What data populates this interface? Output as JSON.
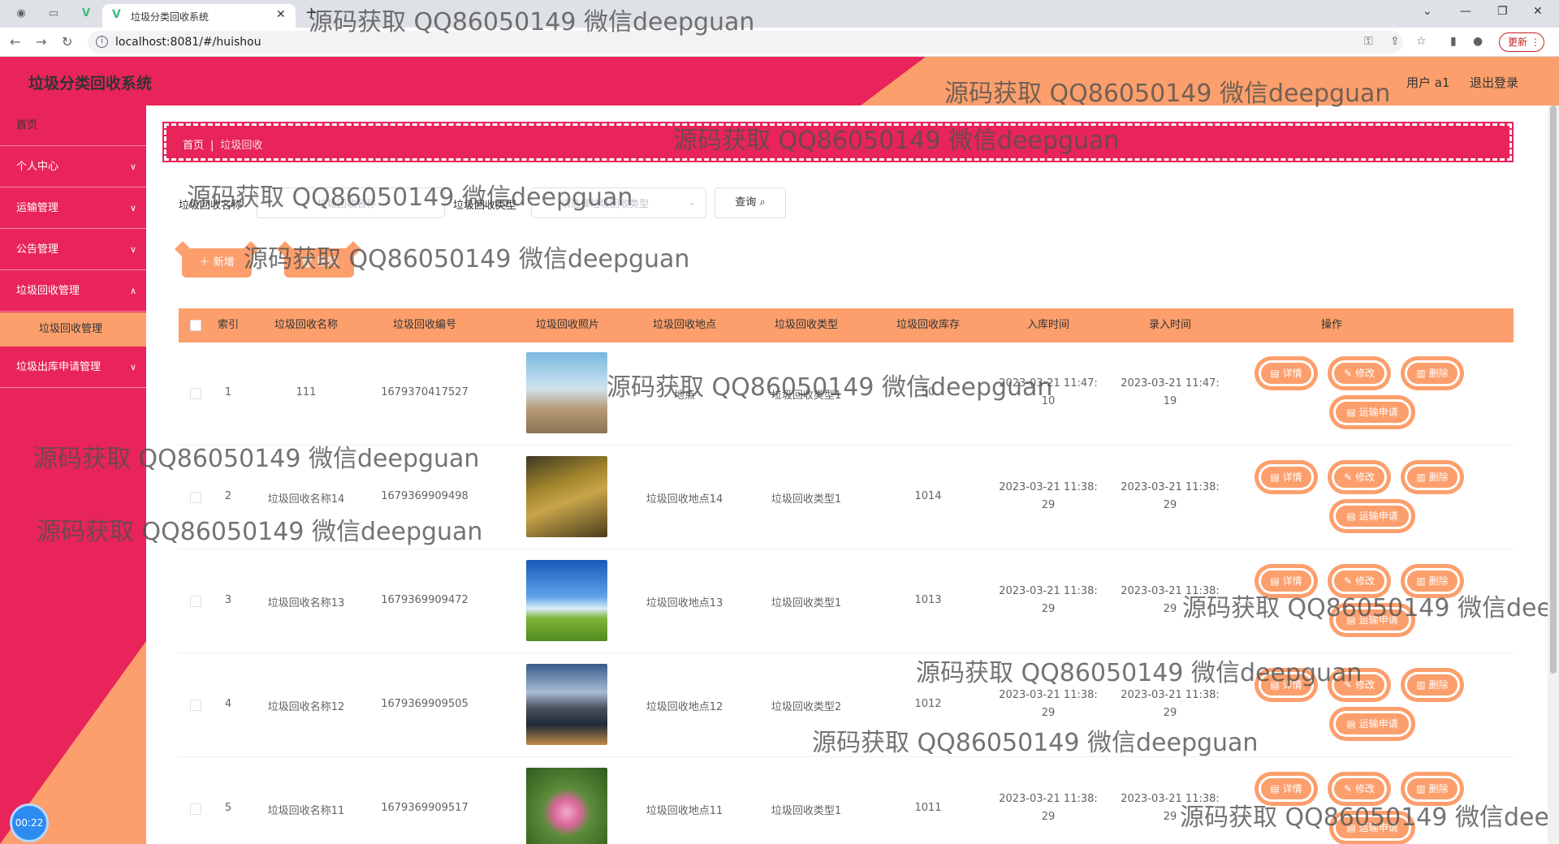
{
  "browser": {
    "tab_title": "垃圾分类回收系统",
    "url": "localhost:8081/#/huishou",
    "update_label": "更新"
  },
  "header": {
    "app_title": "垃圾分类回收系统",
    "user_label": "用户 a1",
    "logout_label": "退出登录"
  },
  "sidebar": {
    "items": [
      {
        "label": "首页"
      },
      {
        "label": "个人中心"
      },
      {
        "label": "运输管理"
      },
      {
        "label": "公告管理"
      },
      {
        "label": "垃圾回收管理"
      },
      {
        "label": "垃圾回收管理"
      },
      {
        "label": "垃圾出库申请管理"
      }
    ],
    "timer": "00:22"
  },
  "breadcrumb": {
    "home": "首页",
    "current": "垃圾回收"
  },
  "filters": {
    "name_label": "垃圾回收名称",
    "name_placeholder": "垃圾回收名称",
    "type_label": "垃圾回收类型",
    "type_placeholder": "请选择垃圾回收类型",
    "search_label": "查询"
  },
  "actions": {
    "add_label": "新增",
    "delete_label": "删除"
  },
  "table": {
    "headers": [
      "索引",
      "垃圾回收名称",
      "垃圾回收编号",
      "垃圾回收照片",
      "垃圾回收地点",
      "垃圾回收类型",
      "垃圾回收库存",
      "入库时间",
      "录入时间",
      "操作"
    ],
    "rows": [
      {
        "index": "1",
        "name": "111",
        "code": "1679370417527",
        "place": "地点",
        "type": "垃圾回收类型1",
        "stock": "50",
        "in_time_1": "2023-03-21 11:47:",
        "in_time_2": "10",
        "rec_time_1": "2023-03-21 11:47:",
        "rec_time_2": "19"
      },
      {
        "index": "2",
        "name": "垃圾回收名称14",
        "code": "1679369909498",
        "place": "垃圾回收地点14",
        "type": "垃圾回收类型1",
        "stock": "1014",
        "in_time_1": "2023-03-21 11:38:",
        "in_time_2": "29",
        "rec_time_1": "2023-03-21 11:38:",
        "rec_time_2": "29"
      },
      {
        "index": "3",
        "name": "垃圾回收名称13",
        "code": "1679369909472",
        "place": "垃圾回收地点13",
        "type": "垃圾回收类型1",
        "stock": "1013",
        "in_time_1": "2023-03-21 11:38:",
        "in_time_2": "29",
        "rec_time_1": "2023-03-21 11:38:",
        "rec_time_2": "29"
      },
      {
        "index": "4",
        "name": "垃圾回收名称12",
        "code": "1679369909505",
        "place": "垃圾回收地点12",
        "type": "垃圾回收类型2",
        "stock": "1012",
        "in_time_1": "2023-03-21 11:38:",
        "in_time_2": "29",
        "rec_time_1": "2023-03-21 11:38:",
        "rec_time_2": "29"
      },
      {
        "index": "5",
        "name": "垃圾回收名称11",
        "code": "1679369909517",
        "place": "垃圾回收地点11",
        "type": "垃圾回收类型1",
        "stock": "1011",
        "in_time_1": "2023-03-21 11:38:",
        "in_time_2": "29",
        "rec_time_1": "2023-03-21 11:38:",
        "rec_time_2": "29"
      }
    ],
    "ops": {
      "detail": "详情",
      "edit": "修改",
      "delete": "删除",
      "transport": "运输申请"
    }
  },
  "watermark": "源码获取 QQ86050149 微信deepguan",
  "colors": {
    "primary": "#e8245a",
    "accent": "#fc9f6c"
  }
}
